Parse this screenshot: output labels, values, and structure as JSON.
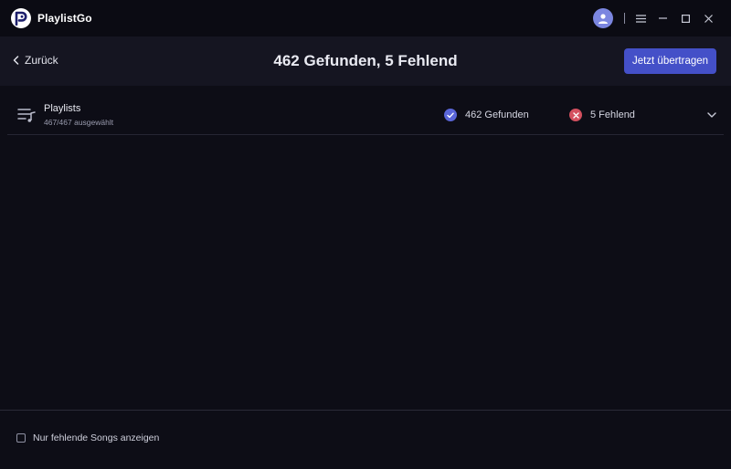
{
  "app": {
    "name": "PlaylistGo"
  },
  "window_controls": [
    "menu-icon",
    "minimize-icon",
    "maximize-icon",
    "close-icon"
  ],
  "header": {
    "back_label": "Zurück",
    "title": "462 Gefunden, 5 Fehlend",
    "transfer_label": "Jetzt übertragen"
  },
  "playlist": {
    "title": "Playlists",
    "subtitle": "467/467 ausgewählt",
    "found_label": "462 Gefunden",
    "missing_label": "5 Fehlend"
  },
  "footer": {
    "checkbox_label": "Nur fehlende Songs anzeigen",
    "checked": false
  },
  "colors": {
    "background": "#0d0d16",
    "header": "#151521",
    "accent": "#4450c8",
    "found": "#5a66d8",
    "missing": "#d4505f"
  }
}
